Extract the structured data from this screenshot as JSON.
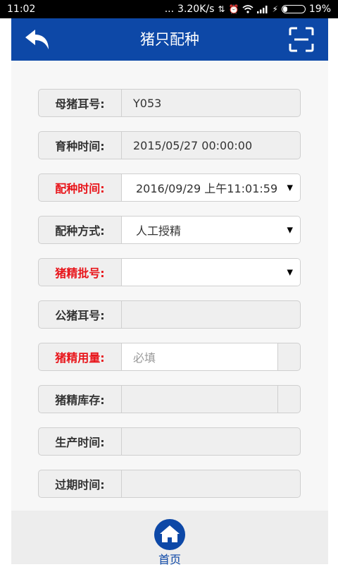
{
  "status_bar": {
    "time": "11:02",
    "dots": "...",
    "network_speed": "3.20K/s",
    "battery": "19%",
    "battery_level": 0.19
  },
  "header": {
    "title": "猪只配种",
    "back_icon": "back-arrow-icon",
    "scan_icon": "scan-icon"
  },
  "form": {
    "sow_ear_tag": {
      "label": "母猪耳号:",
      "value": "Y053"
    },
    "breed_time": {
      "label": "育种时间:",
      "value": "2015/05/27 00:00:00"
    },
    "mating_time": {
      "label": "配种时间:",
      "value": "2016/09/29 上午11:01:59"
    },
    "mating_method": {
      "label": "配种方式:",
      "value": "人工授精"
    },
    "semen_batch": {
      "label": "猪精批号:",
      "value": ""
    },
    "boar_ear_tag": {
      "label": "公猪耳号:",
      "value": ""
    },
    "semen_dosage": {
      "label": "猪精用量:",
      "value": "",
      "placeholder": "必填"
    },
    "semen_stock": {
      "label": "猪精库存:",
      "value": ""
    },
    "production_date": {
      "label": "生产时间:",
      "value": ""
    },
    "expiry_date": {
      "label": "过期时间:",
      "value": ""
    }
  },
  "footer": {
    "home_label": "首页",
    "home_icon": "home-icon"
  },
  "colors": {
    "brand": "#0d48a7",
    "required": "#e8141a"
  }
}
